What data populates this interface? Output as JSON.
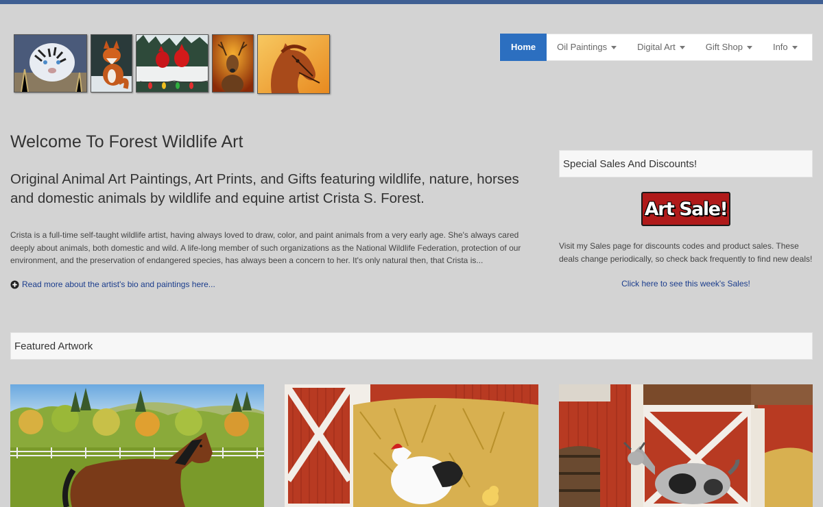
{
  "header": {
    "logo_images": [
      {
        "name": "white-tiger-painting"
      },
      {
        "name": "fox-painting"
      },
      {
        "name": "cardinals-painting"
      },
      {
        "name": "deer-painting"
      },
      {
        "name": "horse-painting"
      }
    ]
  },
  "nav": {
    "items": [
      {
        "label": "Home",
        "active": true
      },
      {
        "label": "Oil Paintings",
        "dropdown": true
      },
      {
        "label": "Digital Art",
        "dropdown": true
      },
      {
        "label": "Gift Shop",
        "dropdown": true
      },
      {
        "label": "Info",
        "dropdown": true
      }
    ]
  },
  "main": {
    "title": "Welcome To Forest Wildlife Art",
    "tagline": "Original Animal Art Paintings, Art Prints, and Gifts featuring wildlife, nature, horses and domestic animals by wildlife and equine artist Crista S. Forest.",
    "bio": "Crista is a full-time self-taught wildlife artist, having always loved to draw, color, and paint animals from a very early age. She's always cared deeply about animals, both domestic and wild. A life-long member of such organizations as the National Wildlife Federation, protection of our environment, and the preservation of endangered species, has always been a concern to her. It's only natural then, that Crista is...",
    "read_more": "Read more about the artist's bio and paintings here..."
  },
  "sidebar": {
    "panel_title": "Special Sales And Discounts!",
    "badge_text": "Art Sale!",
    "description": "Visit my Sales page for discounts codes and product sales. These deals change periodically, so check back frequently to find new deals!",
    "link": "Click here to see this week's Sales!"
  },
  "featured": {
    "title": "Featured Artwork",
    "items": [
      {
        "name": "bay-horse-painting"
      },
      {
        "name": "chicken-barn-painting"
      },
      {
        "name": "goat-barn-painting"
      }
    ]
  },
  "colors": {
    "background": "#d3d3d3",
    "nav_active": "#2c6fc0",
    "link": "#1a3c8c",
    "sale_badge": "#b01a1a",
    "top_bar": "#3f5f93"
  }
}
